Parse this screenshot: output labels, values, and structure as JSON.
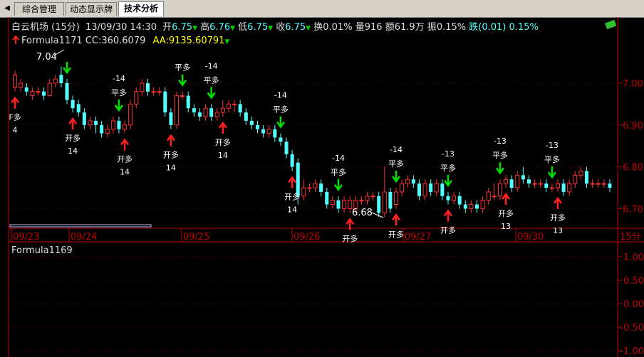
{
  "tabs": [
    {
      "label": "综合管理",
      "active": false
    },
    {
      "label": "动态显示牌",
      "active": false
    },
    {
      "label": "技术分析",
      "active": true
    }
  ],
  "tab_scroll_icon": "left-triangle-icon",
  "header": {
    "name": "白云机场",
    "period": "(15分)",
    "datetime": "13/09/30 14:30",
    "open_label": "开",
    "open": "6.75",
    "high_label": "高",
    "high": "6.76",
    "low_label": "低",
    "low": "6.75",
    "close_label": "收",
    "close": "6.75",
    "turnover_label": "换",
    "turnover": "0.01%",
    "volume_label": "量",
    "volume": "916",
    "amount_label": "额",
    "amount": "61.9万",
    "amplitude_label": "振",
    "amplitude": "0.15%",
    "change_label": "跌",
    "change": "(0.01)",
    "change_pct": "0.15%"
  },
  "formula_line": {
    "name": "Formula1171",
    "cc_label": "CC:",
    "cc": "360.6079",
    "aa_label": "AA:",
    "aa": "9135.60791"
  },
  "lower_panel": {
    "name": "Formula1169",
    "axis_labels": [
      "1.00",
      "0.50",
      "0.00",
      "-0.50",
      "-1.00"
    ]
  },
  "date_labels": [
    "09/23",
    "09/24",
    "09/25",
    "09/26",
    "09/27",
    "09/30"
  ],
  "period_label": "15分",
  "colors": {
    "up": "#ff3232",
    "down": "#54ffff",
    "axis": "#c00000",
    "buy_arrow": "#ff2020",
    "sell_arrow": "#00e000"
  },
  "chart_data": {
    "type": "candlestick",
    "title": "白云机场 (15分)",
    "price_axis_ticks": [
      7.0,
      6.9,
      6.8,
      6.7
    ],
    "ylim": [
      6.665,
      7.09
    ],
    "max_label": "7.04",
    "min_label": "6.68",
    "candles": [
      [
        6.99,
        7.02,
        7.03,
        6.98
      ],
      [
        6.99,
        7.0,
        7.01,
        6.98
      ],
      [
        6.99,
        6.98,
        7.0,
        6.97
      ],
      [
        6.97,
        6.98,
        6.99,
        6.96
      ],
      [
        6.98,
        6.98,
        6.99,
        6.97
      ],
      [
        6.98,
        6.97,
        6.99,
        6.96
      ],
      [
        6.97,
        7.0,
        7.01,
        6.97
      ],
      [
        7.0,
        7.01,
        7.02,
        6.99
      ],
      [
        7.02,
        7.0,
        7.04,
        6.99
      ],
      [
        7.0,
        6.96,
        7.01,
        6.95
      ],
      [
        6.96,
        6.94,
        6.97,
        6.93
      ],
      [
        6.95,
        6.93,
        6.96,
        6.92
      ],
      [
        6.93,
        6.9,
        6.94,
        6.89
      ],
      [
        6.9,
        6.91,
        6.92,
        6.89
      ],
      [
        6.91,
        6.9,
        6.92,
        6.88
      ],
      [
        6.9,
        6.88,
        6.91,
        6.87
      ],
      [
        6.88,
        6.89,
        6.9,
        6.87
      ],
      [
        6.89,
        6.91,
        6.92,
        6.88
      ],
      [
        6.91,
        6.89,
        6.92,
        6.88
      ],
      [
        6.89,
        6.9,
        6.91,
        6.88
      ],
      [
        6.9,
        6.95,
        6.96,
        6.89
      ],
      [
        6.95,
        6.98,
        6.99,
        6.94
      ],
      [
        6.98,
        7.0,
        7.01,
        6.97
      ],
      [
        7.0,
        6.98,
        7.01,
        6.97
      ],
      [
        6.98,
        6.98,
        6.99,
        6.97
      ],
      [
        6.98,
        6.98,
        6.99,
        6.97
      ],
      [
        6.98,
        6.93,
        6.99,
        6.92
      ],
      [
        6.93,
        6.9,
        6.94,
        6.89
      ],
      [
        6.9,
        6.97,
        6.98,
        6.89
      ],
      [
        6.97,
        6.97,
        6.98,
        6.96
      ],
      [
        6.97,
        6.94,
        6.98,
        6.93
      ],
      [
        6.94,
        6.93,
        6.95,
        6.92
      ],
      [
        6.93,
        6.92,
        6.94,
        6.91
      ],
      [
        6.92,
        6.94,
        6.95,
        6.91
      ],
      [
        6.94,
        6.92,
        6.95,
        6.91
      ],
      [
        6.92,
        6.93,
        6.94,
        6.91
      ],
      [
        6.93,
        6.94,
        6.96,
        6.92
      ],
      [
        6.94,
        6.95,
        6.96,
        6.93
      ],
      [
        6.95,
        6.95,
        6.96,
        6.93
      ],
      [
        6.95,
        6.93,
        6.96,
        6.92
      ],
      [
        6.93,
        6.91,
        6.94,
        6.9
      ],
      [
        6.91,
        6.9,
        6.92,
        6.89
      ],
      [
        6.9,
        6.89,
        6.91,
        6.88
      ],
      [
        6.89,
        6.88,
        6.9,
        6.87
      ],
      [
        6.88,
        6.89,
        6.9,
        6.87
      ],
      [
        6.89,
        6.87,
        6.9,
        6.86
      ],
      [
        6.87,
        6.86,
        6.88,
        6.85
      ],
      [
        6.86,
        6.83,
        6.87,
        6.82
      ],
      [
        6.83,
        6.8,
        6.84,
        6.79
      ],
      [
        6.81,
        6.73,
        6.82,
        6.71
      ],
      [
        6.73,
        6.75,
        6.77,
        6.72
      ],
      [
        6.75,
        6.75,
        6.76,
        6.74
      ],
      [
        6.75,
        6.76,
        6.77,
        6.74
      ],
      [
        6.76,
        6.74,
        6.77,
        6.73
      ],
      [
        6.74,
        6.71,
        6.75,
        6.7
      ],
      [
        6.71,
        6.72,
        6.73,
        6.7
      ],
      [
        6.72,
        6.7,
        6.73,
        6.69
      ],
      [
        6.7,
        6.72,
        6.73,
        6.69
      ],
      [
        6.7,
        6.72,
        6.73,
        6.69
      ],
      [
        6.7,
        6.72,
        6.73,
        6.69
      ],
      [
        6.72,
        6.72,
        6.73,
        6.71
      ],
      [
        6.72,
        6.73,
        6.74,
        6.71
      ],
      [
        6.73,
        6.73,
        6.74,
        6.72
      ],
      [
        6.73,
        6.69,
        6.74,
        6.68
      ],
      [
        6.69,
        6.74,
        6.8,
        6.68
      ],
      [
        6.74,
        6.7,
        6.75,
        6.69
      ],
      [
        6.71,
        6.74,
        6.75,
        6.7
      ],
      [
        6.74,
        6.76,
        6.77,
        6.73
      ],
      [
        6.76,
        6.77,
        6.78,
        6.75
      ],
      [
        6.77,
        6.76,
        6.78,
        6.75
      ],
      [
        6.76,
        6.73,
        6.77,
        6.72
      ],
      [
        6.73,
        6.76,
        6.77,
        6.72
      ],
      [
        6.76,
        6.74,
        6.77,
        6.73
      ],
      [
        6.74,
        6.76,
        6.77,
        6.73
      ],
      [
        6.76,
        6.73,
        6.77,
        6.72
      ],
      [
        6.73,
        6.72,
        6.74,
        6.71
      ],
      [
        6.72,
        6.73,
        6.74,
        6.71
      ],
      [
        6.73,
        6.71,
        6.74,
        6.7
      ],
      [
        6.71,
        6.7,
        6.72,
        6.69
      ],
      [
        6.7,
        6.71,
        6.72,
        6.69
      ],
      [
        6.71,
        6.7,
        6.72,
        6.69
      ],
      [
        6.7,
        6.72,
        6.73,
        6.69
      ],
      [
        6.72,
        6.74,
        6.75,
        6.71
      ],
      [
        6.73,
        6.73,
        6.76,
        6.72
      ],
      [
        6.73,
        6.76,
        6.77,
        6.72
      ],
      [
        6.76,
        6.77,
        6.78,
        6.75
      ],
      [
        6.77,
        6.75,
        6.78,
        6.74
      ],
      [
        6.75,
        6.78,
        6.79,
        6.74
      ],
      [
        6.78,
        6.77,
        6.8,
        6.76
      ],
      [
        6.77,
        6.76,
        6.78,
        6.75
      ],
      [
        6.76,
        6.76,
        6.77,
        6.75
      ],
      [
        6.76,
        6.76,
        6.77,
        6.75
      ],
      [
        6.76,
        6.75,
        6.77,
        6.74
      ],
      [
        6.75,
        6.75,
        6.76,
        6.74
      ],
      [
        6.75,
        6.76,
        6.77,
        6.74
      ],
      [
        6.76,
        6.74,
        6.77,
        6.73
      ],
      [
        6.74,
        6.76,
        6.77,
        6.73
      ],
      [
        6.76,
        6.78,
        6.79,
        6.75
      ],
      [
        6.78,
        6.79,
        6.8,
        6.77
      ],
      [
        6.79,
        6.76,
        6.8,
        6.75
      ],
      [
        6.76,
        6.76,
        6.77,
        6.75
      ],
      [
        6.76,
        6.76,
        6.77,
        6.75
      ],
      [
        6.76,
        6.76,
        6.77,
        6.75
      ],
      [
        6.76,
        6.75,
        6.77,
        6.74
      ]
    ],
    "signals_buy": [
      {
        "candle": 0,
        "label": "F多",
        "value": "4"
      },
      {
        "candle": 10,
        "label": "开多",
        "value": "14"
      },
      {
        "candle": 19,
        "label": "开多",
        "value": "14"
      },
      {
        "candle": 27,
        "label": "开多",
        "value": "14"
      },
      {
        "candle": 36,
        "label": "开多",
        "value": "14"
      },
      {
        "candle": 48,
        "label": "开多",
        "value": "14"
      },
      {
        "candle": 58,
        "label": "开多",
        "value": ""
      },
      {
        "candle": 66,
        "label": "开多",
        "value": ""
      },
      {
        "candle": 75,
        "label": "开多",
        "value": ""
      },
      {
        "candle": 85,
        "label": "开多",
        "value": "13"
      },
      {
        "candle": 94,
        "label": "开多",
        "value": "13"
      }
    ],
    "signals_sell": [
      {
        "candle": 9,
        "label": "",
        "value": ""
      },
      {
        "candle": 18,
        "label": "平多",
        "value": "-14"
      },
      {
        "candle": 29,
        "label": "平多",
        "value": ""
      },
      {
        "candle": 34,
        "label": "平多",
        "value": "-14"
      },
      {
        "candle": 46,
        "label": "平多",
        "value": "-14"
      },
      {
        "candle": 56,
        "label": "平多",
        "value": "-14"
      },
      {
        "candle": 66,
        "label": "平多",
        "value": "-14"
      },
      {
        "candle": 75,
        "label": "平多",
        "value": "-13"
      },
      {
        "candle": 84,
        "label": "平多",
        "value": "-13"
      },
      {
        "candle": 93,
        "label": "平多",
        "value": "-13"
      }
    ]
  }
}
